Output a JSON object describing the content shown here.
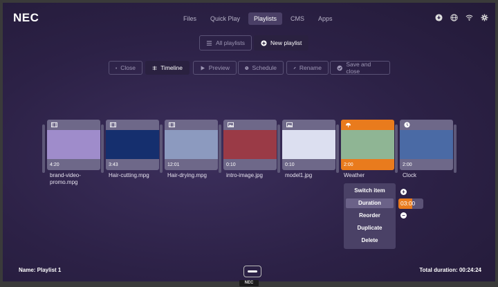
{
  "brand": "NEC",
  "bottom_logo": "NEC",
  "nav": {
    "tabs": [
      {
        "label": "Files",
        "active": false
      },
      {
        "label": "Quick Play",
        "active": false
      },
      {
        "label": "Playlists",
        "active": true
      },
      {
        "label": "CMS",
        "active": false
      },
      {
        "label": "Apps",
        "active": false
      }
    ]
  },
  "sys_icons": [
    "download-icon",
    "globe-icon",
    "wifi-icon",
    "gear-icon"
  ],
  "playlist_toolbar": {
    "all_playlists": "All playlists",
    "new_playlist": "New playlist"
  },
  "editor_toolbar": {
    "close": "Close",
    "timeline": "Timeline",
    "preview": "Preview",
    "schedule": "Schedule",
    "rename": "Rename",
    "save_close": "Save and close"
  },
  "items": [
    {
      "name": "brand-video-promo.mpg",
      "label_lines": [
        "brand-video-",
        "promo.mpg"
      ],
      "duration": "4:20",
      "type": "video",
      "thumb_color": "#9f8ccb",
      "selected": false
    },
    {
      "name": "Hair-cutting.mpg",
      "label_lines": [
        "Hair-cutting.mpg"
      ],
      "duration": "3:43",
      "type": "video",
      "thumb_color": "#152f6e",
      "selected": false
    },
    {
      "name": "Hair-drying.mpg",
      "label_lines": [
        "Hair-drying.mpg"
      ],
      "duration": "12:01",
      "type": "video",
      "thumb_color": "#8c9abf",
      "selected": false
    },
    {
      "name": "intro-image.jpg",
      "label_lines": [
        "intro-image.jpg"
      ],
      "duration": "0:10",
      "type": "image",
      "thumb_color": "#9a3a46",
      "selected": false
    },
    {
      "name": "model1.jpg",
      "label_lines": [
        "model1.jpg"
      ],
      "duration": "0:10",
      "type": "image",
      "thumb_color": "#dcdff0",
      "selected": false
    },
    {
      "name": "Weather",
      "label_lines": [
        "Weather"
      ],
      "duration": "2:00",
      "type": "weather",
      "thumb_color": "#8fb594",
      "selected": true
    },
    {
      "name": "Clock",
      "label_lines": [
        "Clock"
      ],
      "duration": "2:00",
      "type": "clock",
      "thumb_color": "#4a6aa5",
      "selected": false
    }
  ],
  "context_menu": {
    "items": [
      {
        "label": "Switch item",
        "active": false
      },
      {
        "label": "Duration",
        "active": true
      },
      {
        "label": "Reorder",
        "active": false
      },
      {
        "label": "Duplicate",
        "active": false
      },
      {
        "label": "Delete",
        "active": false
      }
    ],
    "duration_value": "03:00",
    "increment": "+",
    "decrement": "−"
  },
  "footer": {
    "name": "Name: Playlist 1",
    "total": "Total duration: 00:24:24"
  },
  "colors": {
    "accent": "#e97b1d",
    "background": "#2c2146",
    "card": "#6e6889"
  }
}
